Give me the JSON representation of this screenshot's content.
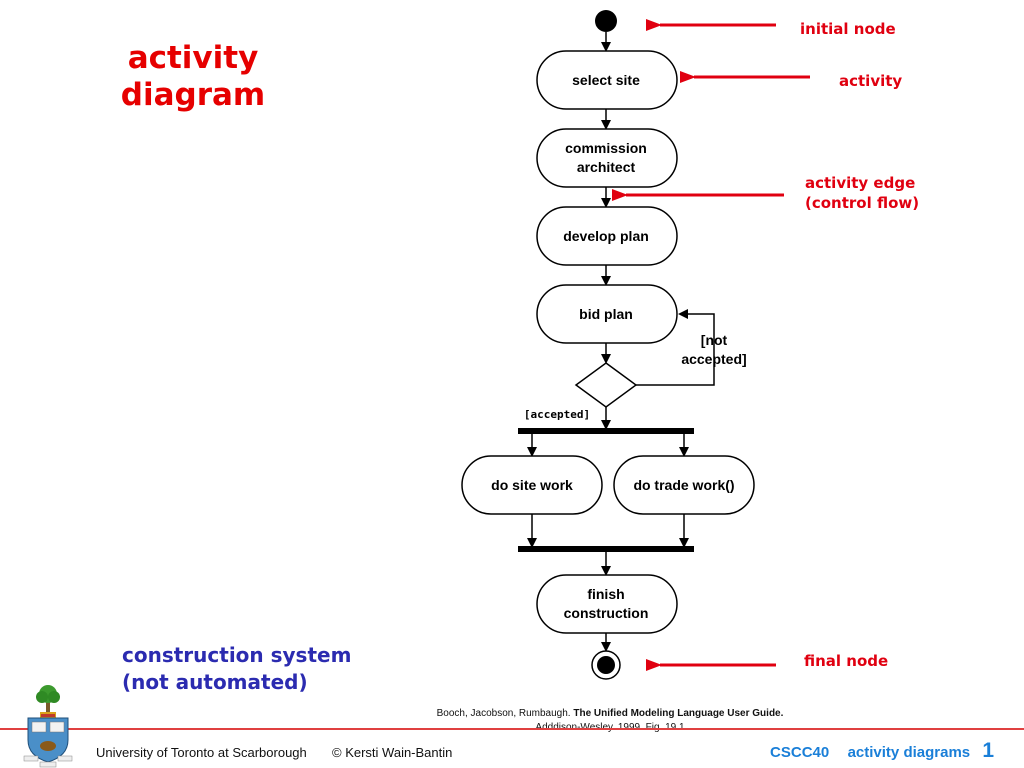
{
  "slide": {
    "title_line1": "activity",
    "title_line2": "diagram",
    "subtitle_line1": "construction system",
    "subtitle_line2": "(not automated)"
  },
  "diagram": {
    "activities": [
      {
        "id": "select-site",
        "lines": [
          "select site"
        ]
      },
      {
        "id": "commission-architect",
        "lines": [
          "commission",
          "architect"
        ]
      },
      {
        "id": "develop-plan",
        "lines": [
          "develop plan"
        ]
      },
      {
        "id": "bid-plan",
        "lines": [
          "bid plan"
        ]
      },
      {
        "id": "do-site-work",
        "lines": [
          "do site work"
        ]
      },
      {
        "id": "do-trade-work",
        "lines": [
          "do trade work()"
        ]
      },
      {
        "id": "finish-construction",
        "lines": [
          "finish",
          "construction"
        ]
      }
    ],
    "guards": {
      "not_accepted_line1": "[not",
      "not_accepted_line2": "accepted]",
      "accepted": "[accepted]"
    }
  },
  "callouts": {
    "initial_node": "initial node",
    "activity": "activity",
    "activity_edge_line1": "activity edge",
    "activity_edge_line2": "(control flow)",
    "final_node": "final node"
  },
  "citation": {
    "authors": "Booch, Jacobson, Rumbaugh.",
    "book": "The Unified Modeling Language User Guide.",
    "publisher_line": "Adddison-Wesley. 1999.  Fig. 19.1"
  },
  "footer": {
    "institution": "University of Toronto at Scarborough",
    "copyright": "© Kersti Wain-Bantin",
    "course": "CSCC40",
    "topic": "activity diagrams",
    "page_number": "1"
  },
  "colors": {
    "title_red": "#e60000",
    "subtitle_blue": "#2b2bb0",
    "callout_red": "#e00010",
    "footer_blue": "#1a7fd8",
    "footer_rule": "#e04040"
  }
}
